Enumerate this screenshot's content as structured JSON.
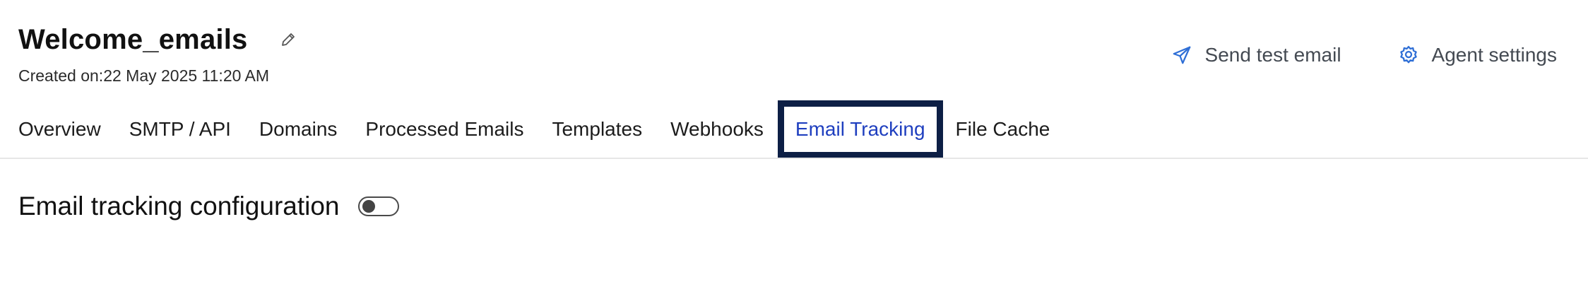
{
  "header": {
    "title": "Welcome_emails",
    "created_label": "Created on:22 May 2025 11:20 AM"
  },
  "actions": {
    "send_test_email": "Send test email",
    "agent_settings": "Agent settings"
  },
  "tabs": [
    {
      "label": "Overview"
    },
    {
      "label": "SMTP / API"
    },
    {
      "label": "Domains"
    },
    {
      "label": "Processed Emails"
    },
    {
      "label": "Templates"
    },
    {
      "label": "Webhooks"
    },
    {
      "label": "Email Tracking",
      "active": true
    },
    {
      "label": "File Cache"
    }
  ],
  "section": {
    "title": "Email tracking configuration",
    "toggle_state": "off"
  },
  "colors": {
    "accent": "#1f3fbf",
    "icon_blue": "#2f6fd6",
    "focus_border": "#0d1f45"
  },
  "icons": {
    "edit": "pencil-icon",
    "send": "paper-plane-icon",
    "settings": "gear-icon"
  }
}
